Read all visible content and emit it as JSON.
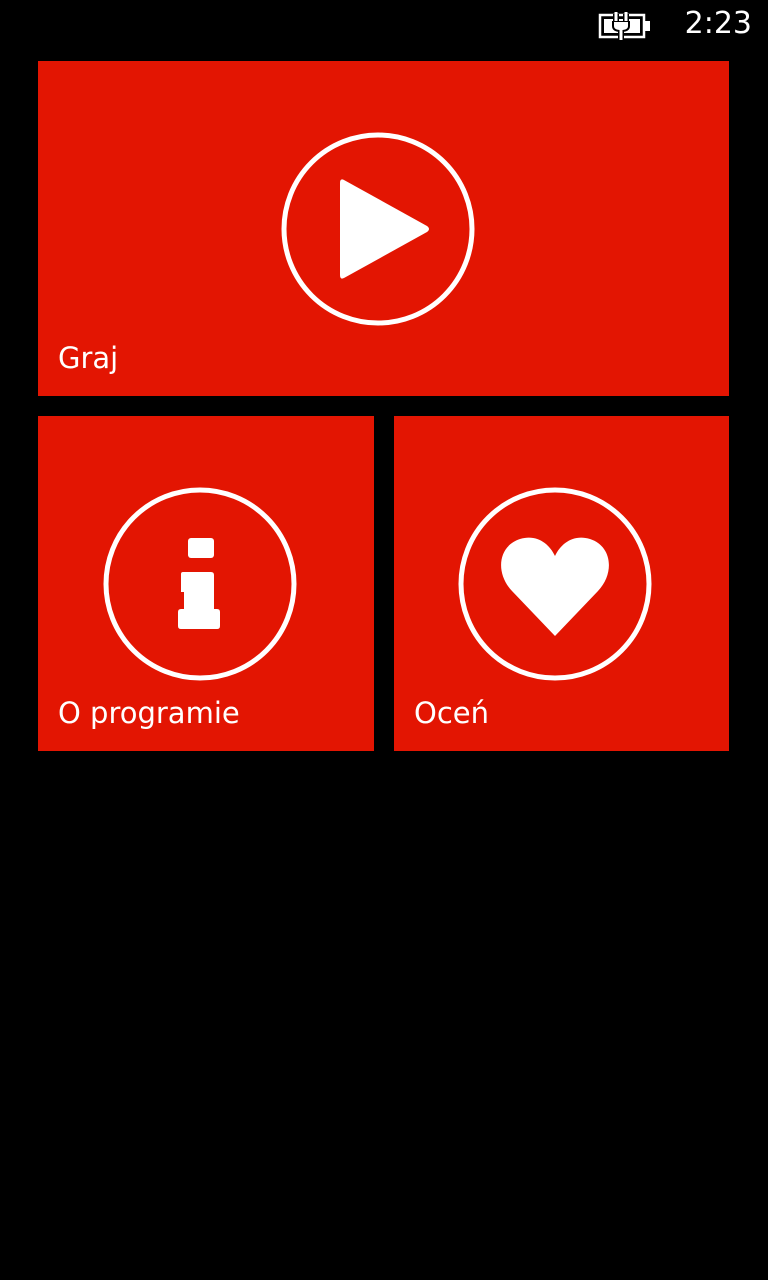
{
  "status_bar": {
    "time": "2:23",
    "battery_icon": "battery-charging-icon"
  },
  "theme": {
    "accent": "#e31502",
    "background": "#000000",
    "foreground": "#ffffff"
  },
  "tiles": [
    {
      "label": "Graj",
      "icon": "play-icon"
    },
    {
      "label": "O programie",
      "icon": "info-icon"
    },
    {
      "label": "Oceń",
      "icon": "heart-icon"
    }
  ]
}
